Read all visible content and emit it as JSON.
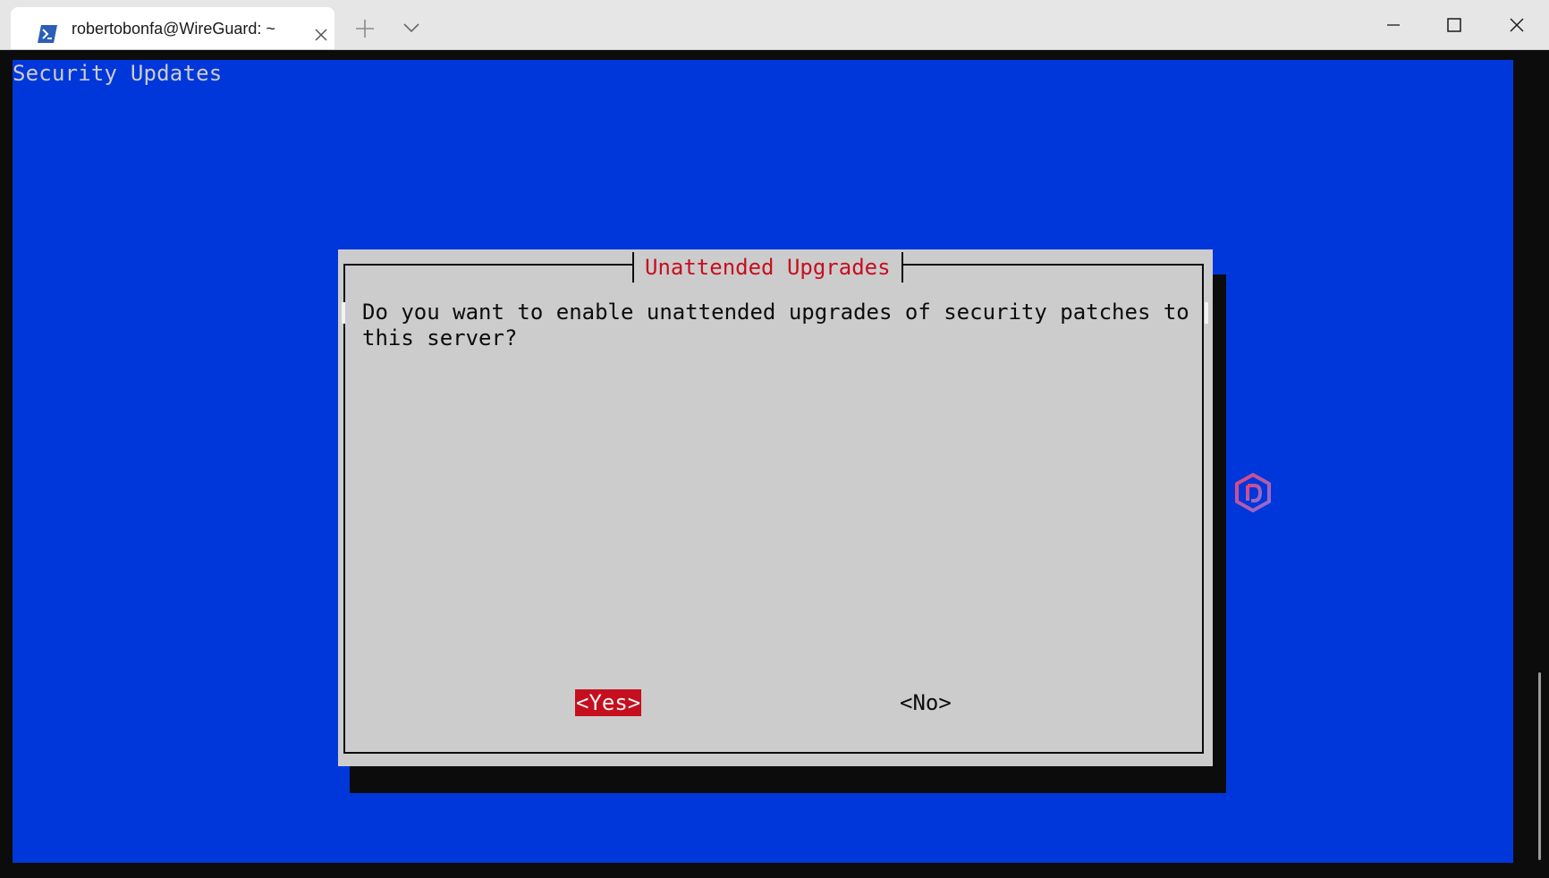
{
  "window": {
    "tab_title": "robertobonfa@WireGuard: ~",
    "tab_icon": "powershell-icon",
    "new_tab_icon": "plus-icon",
    "dropdown_icon": "chevron-down-icon",
    "controls": [
      "minimize-icon",
      "maximize-icon",
      "close-icon"
    ]
  },
  "terminal": {
    "background_color": "#0037da",
    "backtitle": "Security Updates"
  },
  "dialog": {
    "title": "Unattended Upgrades",
    "title_color": "#c50f1f",
    "message_line1": "Do you want to enable unattended upgrades of security patches to",
    "message_line2": "this server?",
    "yes_label": "<Yes>",
    "no_label": "<No>",
    "selected_button": "yes",
    "selected_color": "#c50f1f"
  },
  "watermark": {
    "icon": "hexagon-logo-icon"
  }
}
